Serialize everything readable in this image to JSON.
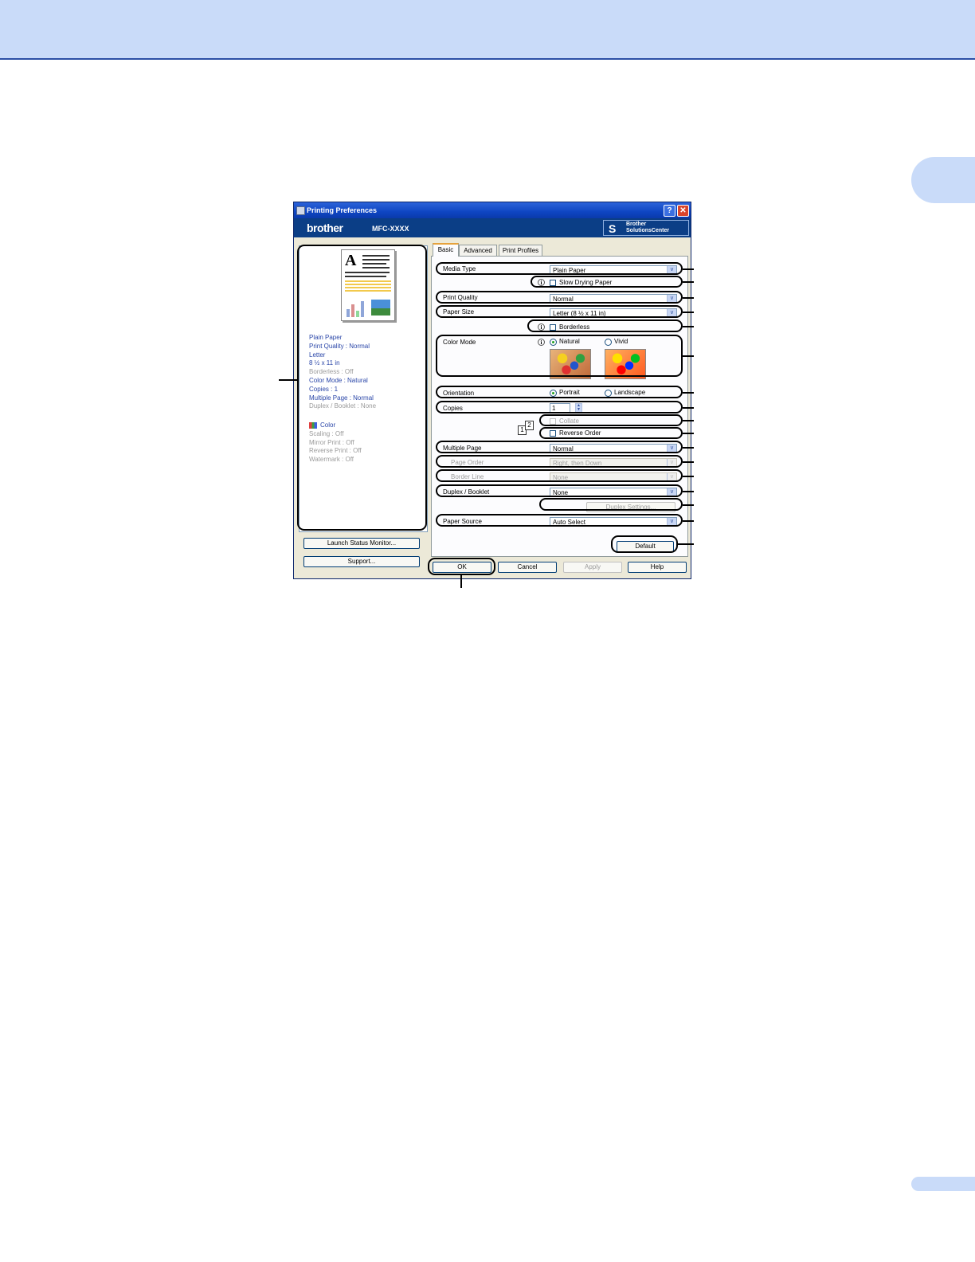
{
  "dialog": {
    "title": "Printing Preferences",
    "help_glyph": "?",
    "close_glyph": "✕",
    "brand": "brother",
    "model": "MFC-XXXX",
    "solutions_line1": "Brother",
    "solutions_line2": "SolutionsCenter"
  },
  "tabs": [
    "Basic",
    "Advanced",
    "Print Profiles"
  ],
  "preview": {
    "summary": [
      "Plain Paper",
      "Print Quality : Normal",
      "Letter",
      "8 ½ x 11 in",
      "Borderless : Off",
      "Color Mode : Natural",
      "Copies : 1",
      "Multiple Page : Normal",
      "Duplex / Booklet : None"
    ],
    "color_label": "Color",
    "summary2": [
      "Scaling : Off",
      "Mirror Print : Off",
      "Reverse Print : Off",
      "Watermark : Off"
    ]
  },
  "left_buttons": {
    "launch_status": "Launch Status Monitor...",
    "support": "Support..."
  },
  "basic": {
    "media_type_label": "Media Type",
    "media_type_value": "Plain Paper",
    "slow_drying_label": "Slow Drying Paper",
    "print_quality_label": "Print Quality",
    "print_quality_value": "Normal",
    "paper_size_label": "Paper Size",
    "paper_size_value": "Letter (8 ½ x 11 in)",
    "borderless_label": "Borderless",
    "color_mode_label": "Color Mode",
    "natural_label": "Natural",
    "vivid_label": "Vivid",
    "orientation_label": "Orientation",
    "portrait_label": "Portrait",
    "landscape_label": "Landscape",
    "copies_label": "Copies",
    "copies_value": "1",
    "collate_label": "Collate",
    "reverse_order_label": "Reverse Order",
    "multiple_page_label": "Multiple Page",
    "multiple_page_value": "Normal",
    "page_order_label": "Page Order",
    "page_order_value": "Right, then Down",
    "border_line_label": "Border Line",
    "border_line_value": "None",
    "duplex_label": "Duplex / Booklet",
    "duplex_value": "None",
    "duplex_settings_label": "Duplex Settings...",
    "paper_source_label": "Paper Source",
    "paper_source_value": "Auto Select",
    "default_label": "Default",
    "info_glyph": "i",
    "arrow_glyph": "v"
  },
  "footer_buttons": {
    "ok": "OK",
    "cancel": "Cancel",
    "apply": "Apply",
    "help": "Help"
  },
  "colors": {
    "header_band": "#c9dbf9",
    "titlebar": "#0e45c2",
    "brand_bar": "#0b3e86",
    "summary_text": "#2a46a8"
  }
}
